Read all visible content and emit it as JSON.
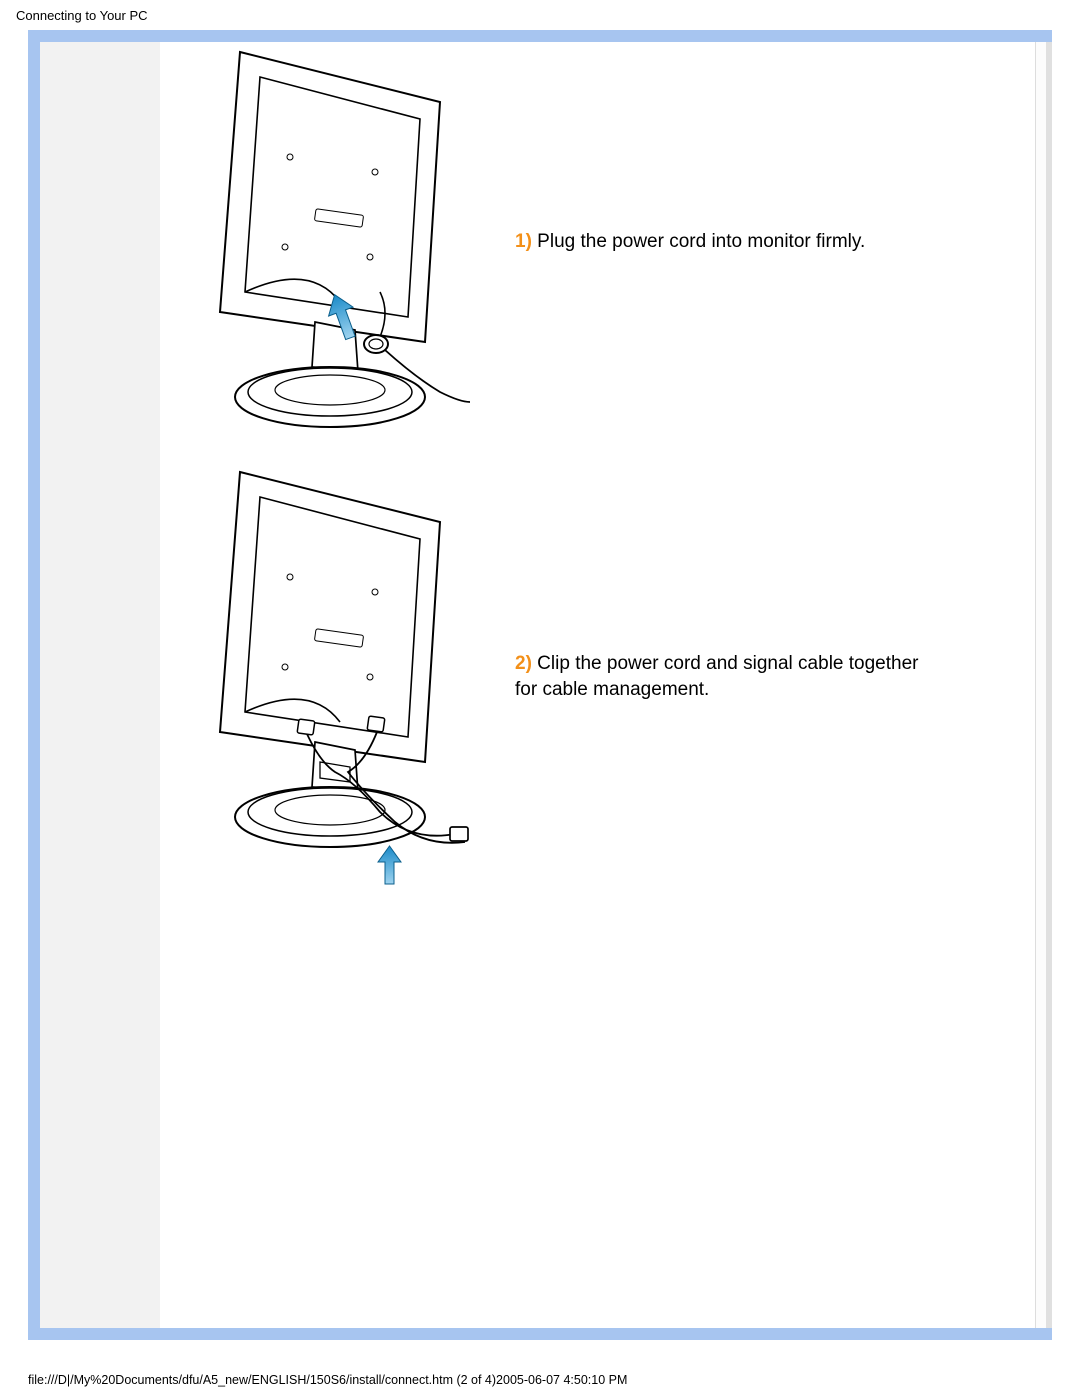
{
  "header": {
    "title": "Connecting to Your PC"
  },
  "steps": [
    {
      "num": "1)",
      "text": " Plug the power cord into monitor firmly."
    },
    {
      "num": "2)",
      "text": " Clip the power cord and signal cable together for cable management."
    }
  ],
  "footer": {
    "text": "file:///D|/My%20Documents/dfu/A5_new/ENGLISH/150S6/install/connect.htm (2 of 4)2005-06-07 4:50:10 PM"
  }
}
